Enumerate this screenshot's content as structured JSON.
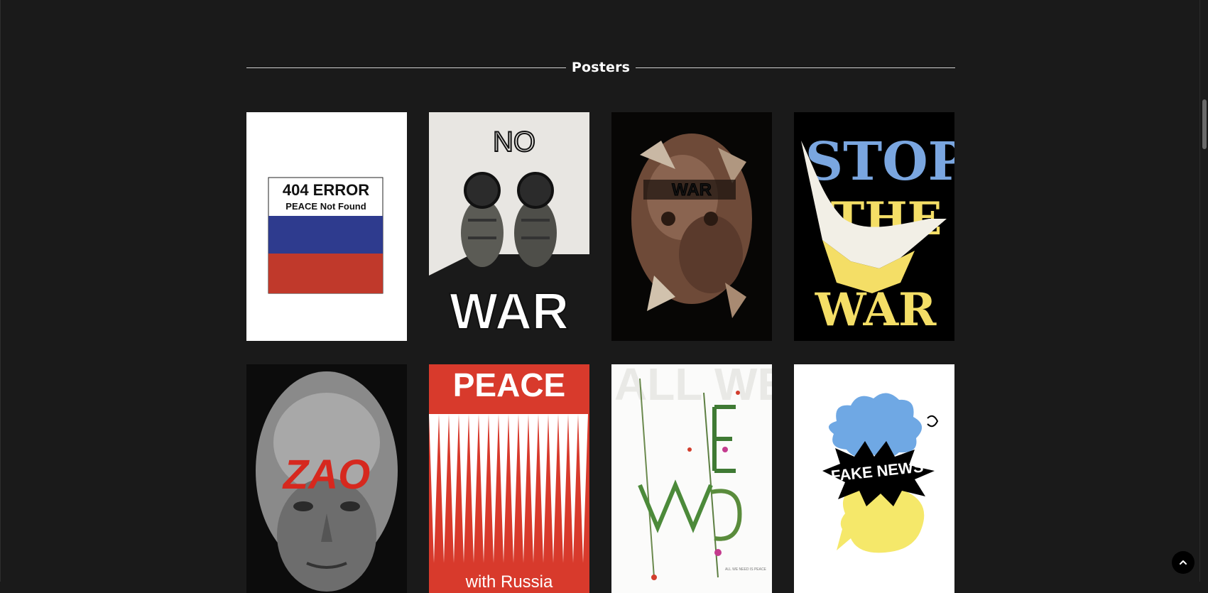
{
  "section": {
    "title": "Posters"
  },
  "posters": [
    {
      "name": "poster-404-error",
      "line1": "404 ERROR",
      "line2": "PEACE Not Found",
      "colors": {
        "white": "#ffffff",
        "blue": "#2e3b8e",
        "red": "#c0392b"
      }
    },
    {
      "name": "poster-no-war-grenades",
      "top_text": "NO",
      "bottom_text": "WAR"
    },
    {
      "name": "poster-war-collage",
      "text": "WAR"
    },
    {
      "name": "poster-stop-the-war",
      "line1": "STOP",
      "line2": "THE",
      "line3": "WAR",
      "colors": {
        "blue": "#7aa6e0",
        "yellow": "#f4de66"
      }
    },
    {
      "name": "poster-zao",
      "text": "ZAO",
      "colors": {
        "red": "#d6281e"
      }
    },
    {
      "name": "poster-peace-with-russia",
      "title": "PEACE",
      "subtitle": "with Russia",
      "colors": {
        "red": "#d83a2c"
      }
    },
    {
      "name": "poster-all-we-need-is-peace",
      "letters": "ALL WE NEED IS",
      "caption": "ALL WE NEED IS PEACE"
    },
    {
      "name": "poster-fake-news",
      "text": "FAKE NEWS",
      "colors": {
        "blue": "#6fa8e4",
        "yellow": "#f5e86a"
      }
    }
  ],
  "scroll_to_top": {
    "icon": "chevron-up-icon"
  }
}
